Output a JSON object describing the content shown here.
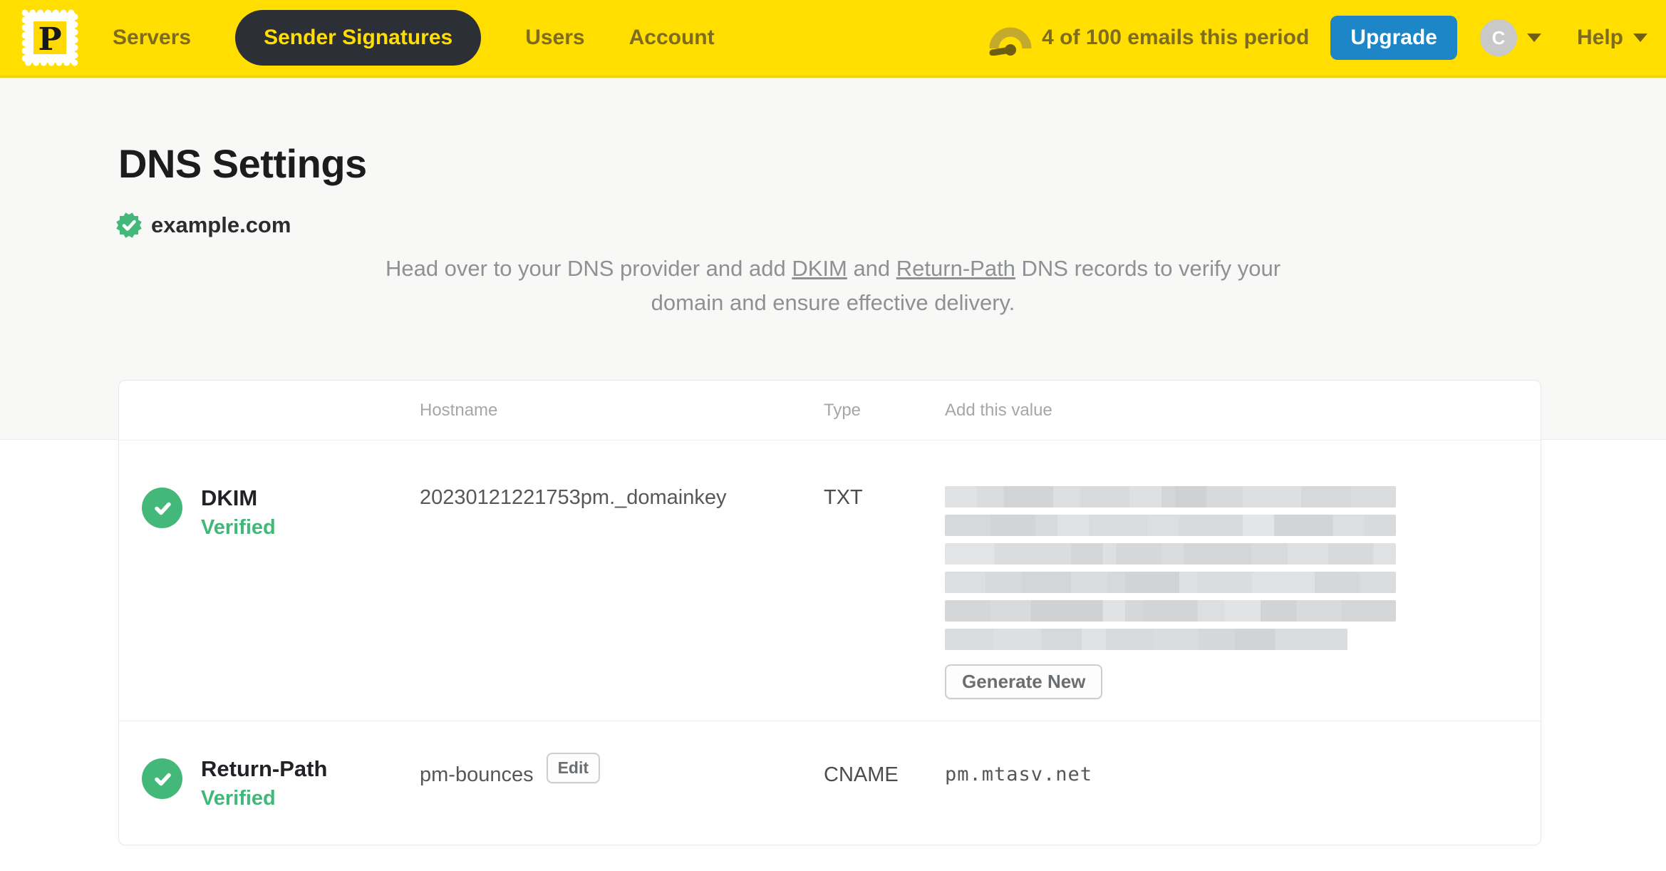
{
  "colors": {
    "brand_yellow": "#FFDE00",
    "upgrade_blue": "#1D86C8",
    "verified_green": "#44B878"
  },
  "nav": {
    "logo_letter": "P",
    "items": [
      {
        "label": "Servers",
        "active": false
      },
      {
        "label": "Sender Signatures",
        "active": true
      },
      {
        "label": "Users",
        "active": false
      },
      {
        "label": "Account",
        "active": false
      }
    ],
    "usage_text": "4 of 100 emails this period",
    "upgrade_label": "Upgrade",
    "avatar_initial": "C",
    "help_label": "Help"
  },
  "page": {
    "title": "DNS Settings",
    "domain": "example.com",
    "intro": {
      "part1": "Head over to your DNS provider and add ",
      "link1": "DKIM",
      "part2": " and ",
      "link2": "Return-Path",
      "part3": " DNS records to verify your domain and ensure effective delivery."
    }
  },
  "table": {
    "headers": {
      "hostname": "Hostname",
      "type": "Type",
      "value": "Add this value"
    },
    "rows": [
      {
        "name": "DKIM",
        "status": "Verified",
        "hostname": "20230121221753pm._domainkey",
        "type": "TXT",
        "value_redacted": true,
        "action_label": "Generate New"
      },
      {
        "name": "Return-Path",
        "status": "Verified",
        "hostname": "pm-bounces",
        "edit_label": "Edit",
        "type": "CNAME",
        "value": "pm.mtasv.net"
      }
    ]
  }
}
